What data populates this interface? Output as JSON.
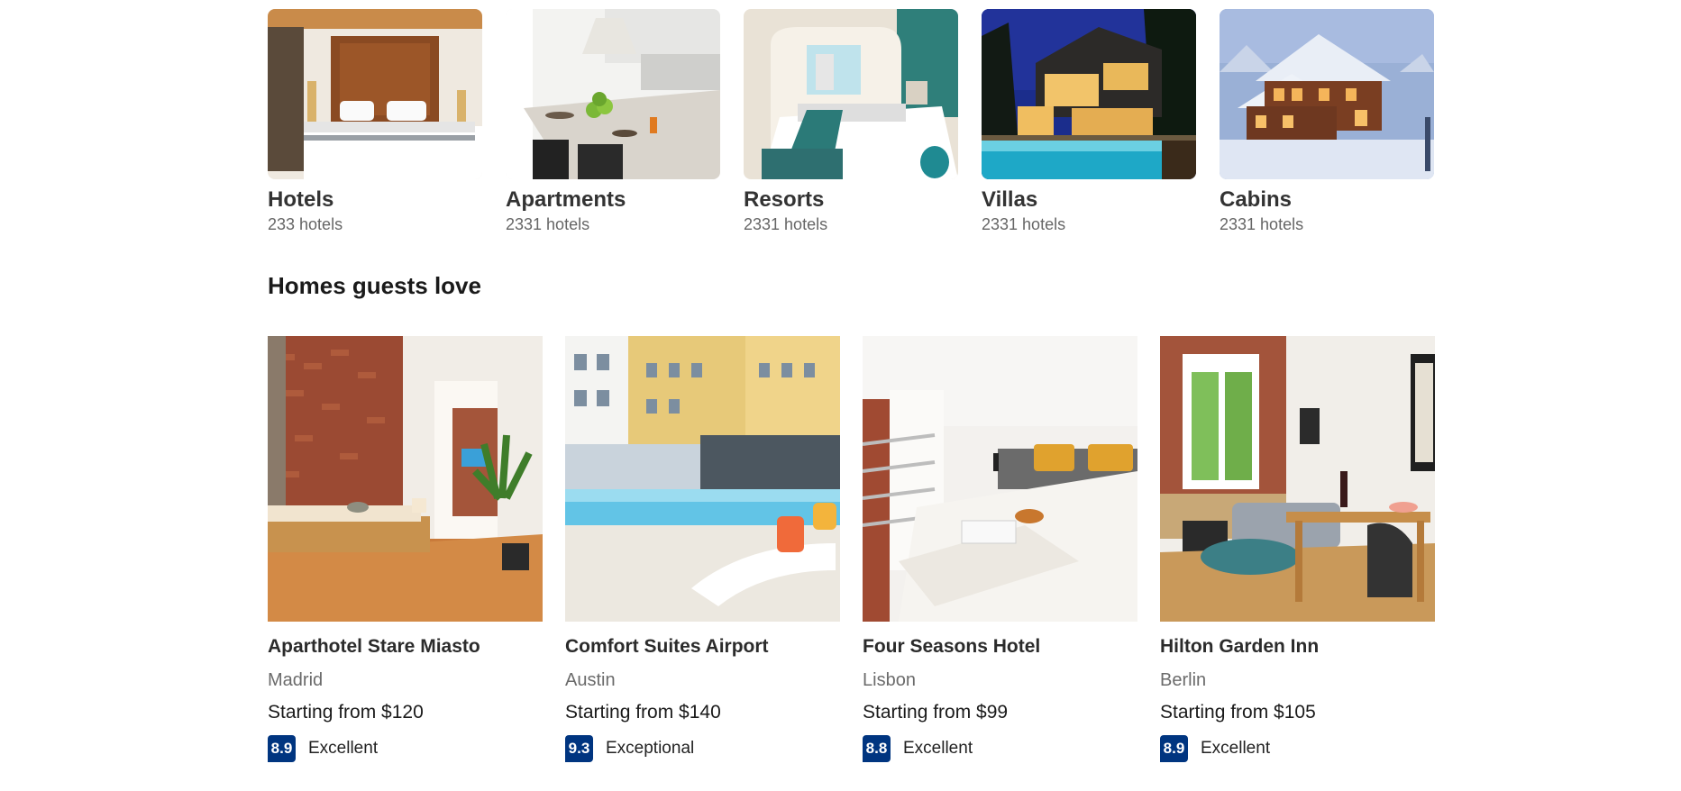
{
  "property_types": [
    {
      "name": "Hotels",
      "count": "233 hotels",
      "image": "hotel-bedroom-image"
    },
    {
      "name": "Apartments",
      "count": "2331 hotels",
      "image": "apartment-kitchen-image"
    },
    {
      "name": "Resorts",
      "count": "2331 hotels",
      "image": "resort-room-image"
    },
    {
      "name": "Villas",
      "count": "2331 hotels",
      "image": "villa-pool-night-image"
    },
    {
      "name": "Cabins",
      "count": "2331 hotels",
      "image": "snowy-cabin-image"
    }
  ],
  "homes_section": {
    "title": "Homes guests love"
  },
  "homes": [
    {
      "name": "Aparthotel Stare Miasto",
      "city": "Madrid",
      "price": "Starting from $120",
      "score": "8.9",
      "rating": "Excellent"
    },
    {
      "name": "Comfort Suites Airport",
      "city": "Austin",
      "price": "Starting from $140",
      "score": "9.3",
      "rating": "Exceptional"
    },
    {
      "name": "Four Seasons Hotel",
      "city": "Lisbon",
      "price": "Starting from $99",
      "score": "8.8",
      "rating": "Excellent"
    },
    {
      "name": "Hilton Garden Inn",
      "city": "Berlin",
      "price": "Starting from $105",
      "score": "8.9",
      "rating": "Excellent"
    }
  ],
  "colors": {
    "score_badge": "#003580",
    "text_primary": "#222222",
    "text_secondary": "#666666"
  }
}
